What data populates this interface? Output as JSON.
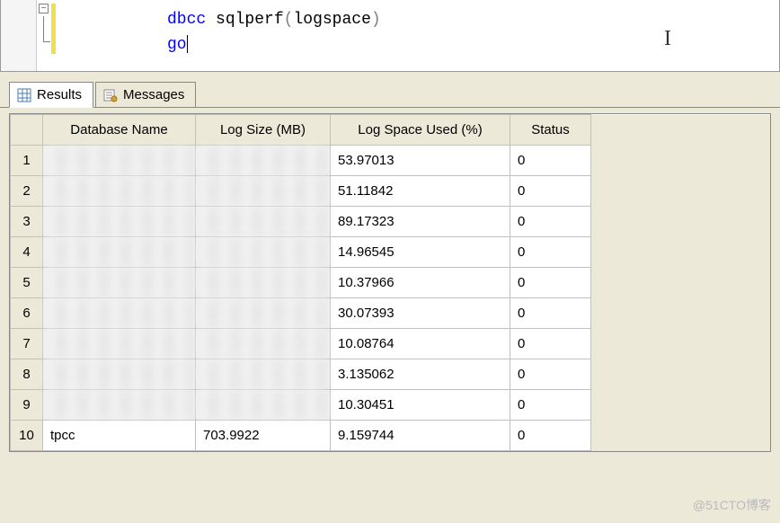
{
  "editor": {
    "line1_kw1": "dbcc",
    "line1_fn": "sqlperf",
    "line1_open": "(",
    "line1_arg": "logspace",
    "line1_close": ")",
    "line2": "go"
  },
  "tabs": {
    "results": "Results",
    "messages": "Messages"
  },
  "grid": {
    "headers": {
      "dbname": "Database Name",
      "logsize": "Log Size (MB)",
      "logused": "Log Space Used (%)",
      "status": "Status"
    },
    "rows": [
      {
        "num": "1",
        "dbname": "",
        "logsize": "",
        "logused": "53.97013",
        "status": "0",
        "blurred": true
      },
      {
        "num": "2",
        "dbname": "",
        "logsize": "",
        "logused": "51.11842",
        "status": "0",
        "blurred": true
      },
      {
        "num": "3",
        "dbname": "",
        "logsize": "",
        "logused": "89.17323",
        "status": "0",
        "blurred": true
      },
      {
        "num": "4",
        "dbname": "",
        "logsize": "",
        "logused": "14.96545",
        "status": "0",
        "blurred": true
      },
      {
        "num": "5",
        "dbname": "",
        "logsize": "",
        "logused": "10.37966",
        "status": "0",
        "blurred": true
      },
      {
        "num": "6",
        "dbname": "",
        "logsize": "",
        "logused": "30.07393",
        "status": "0",
        "blurred": true
      },
      {
        "num": "7",
        "dbname": "",
        "logsize": "",
        "logused": "10.08764",
        "status": "0",
        "blurred": true
      },
      {
        "num": "8",
        "dbname": "",
        "logsize": "",
        "logused": "3.135062",
        "status": "0",
        "blurred": true
      },
      {
        "num": "9",
        "dbname": "",
        "logsize": "",
        "logused": "10.30451",
        "status": "0",
        "blurred": true
      },
      {
        "num": "10",
        "dbname": "tpcc",
        "logsize": "703.9922",
        "logused": "9.159744",
        "status": "0",
        "blurred": false
      }
    ]
  },
  "watermark": "@51CTO博客"
}
